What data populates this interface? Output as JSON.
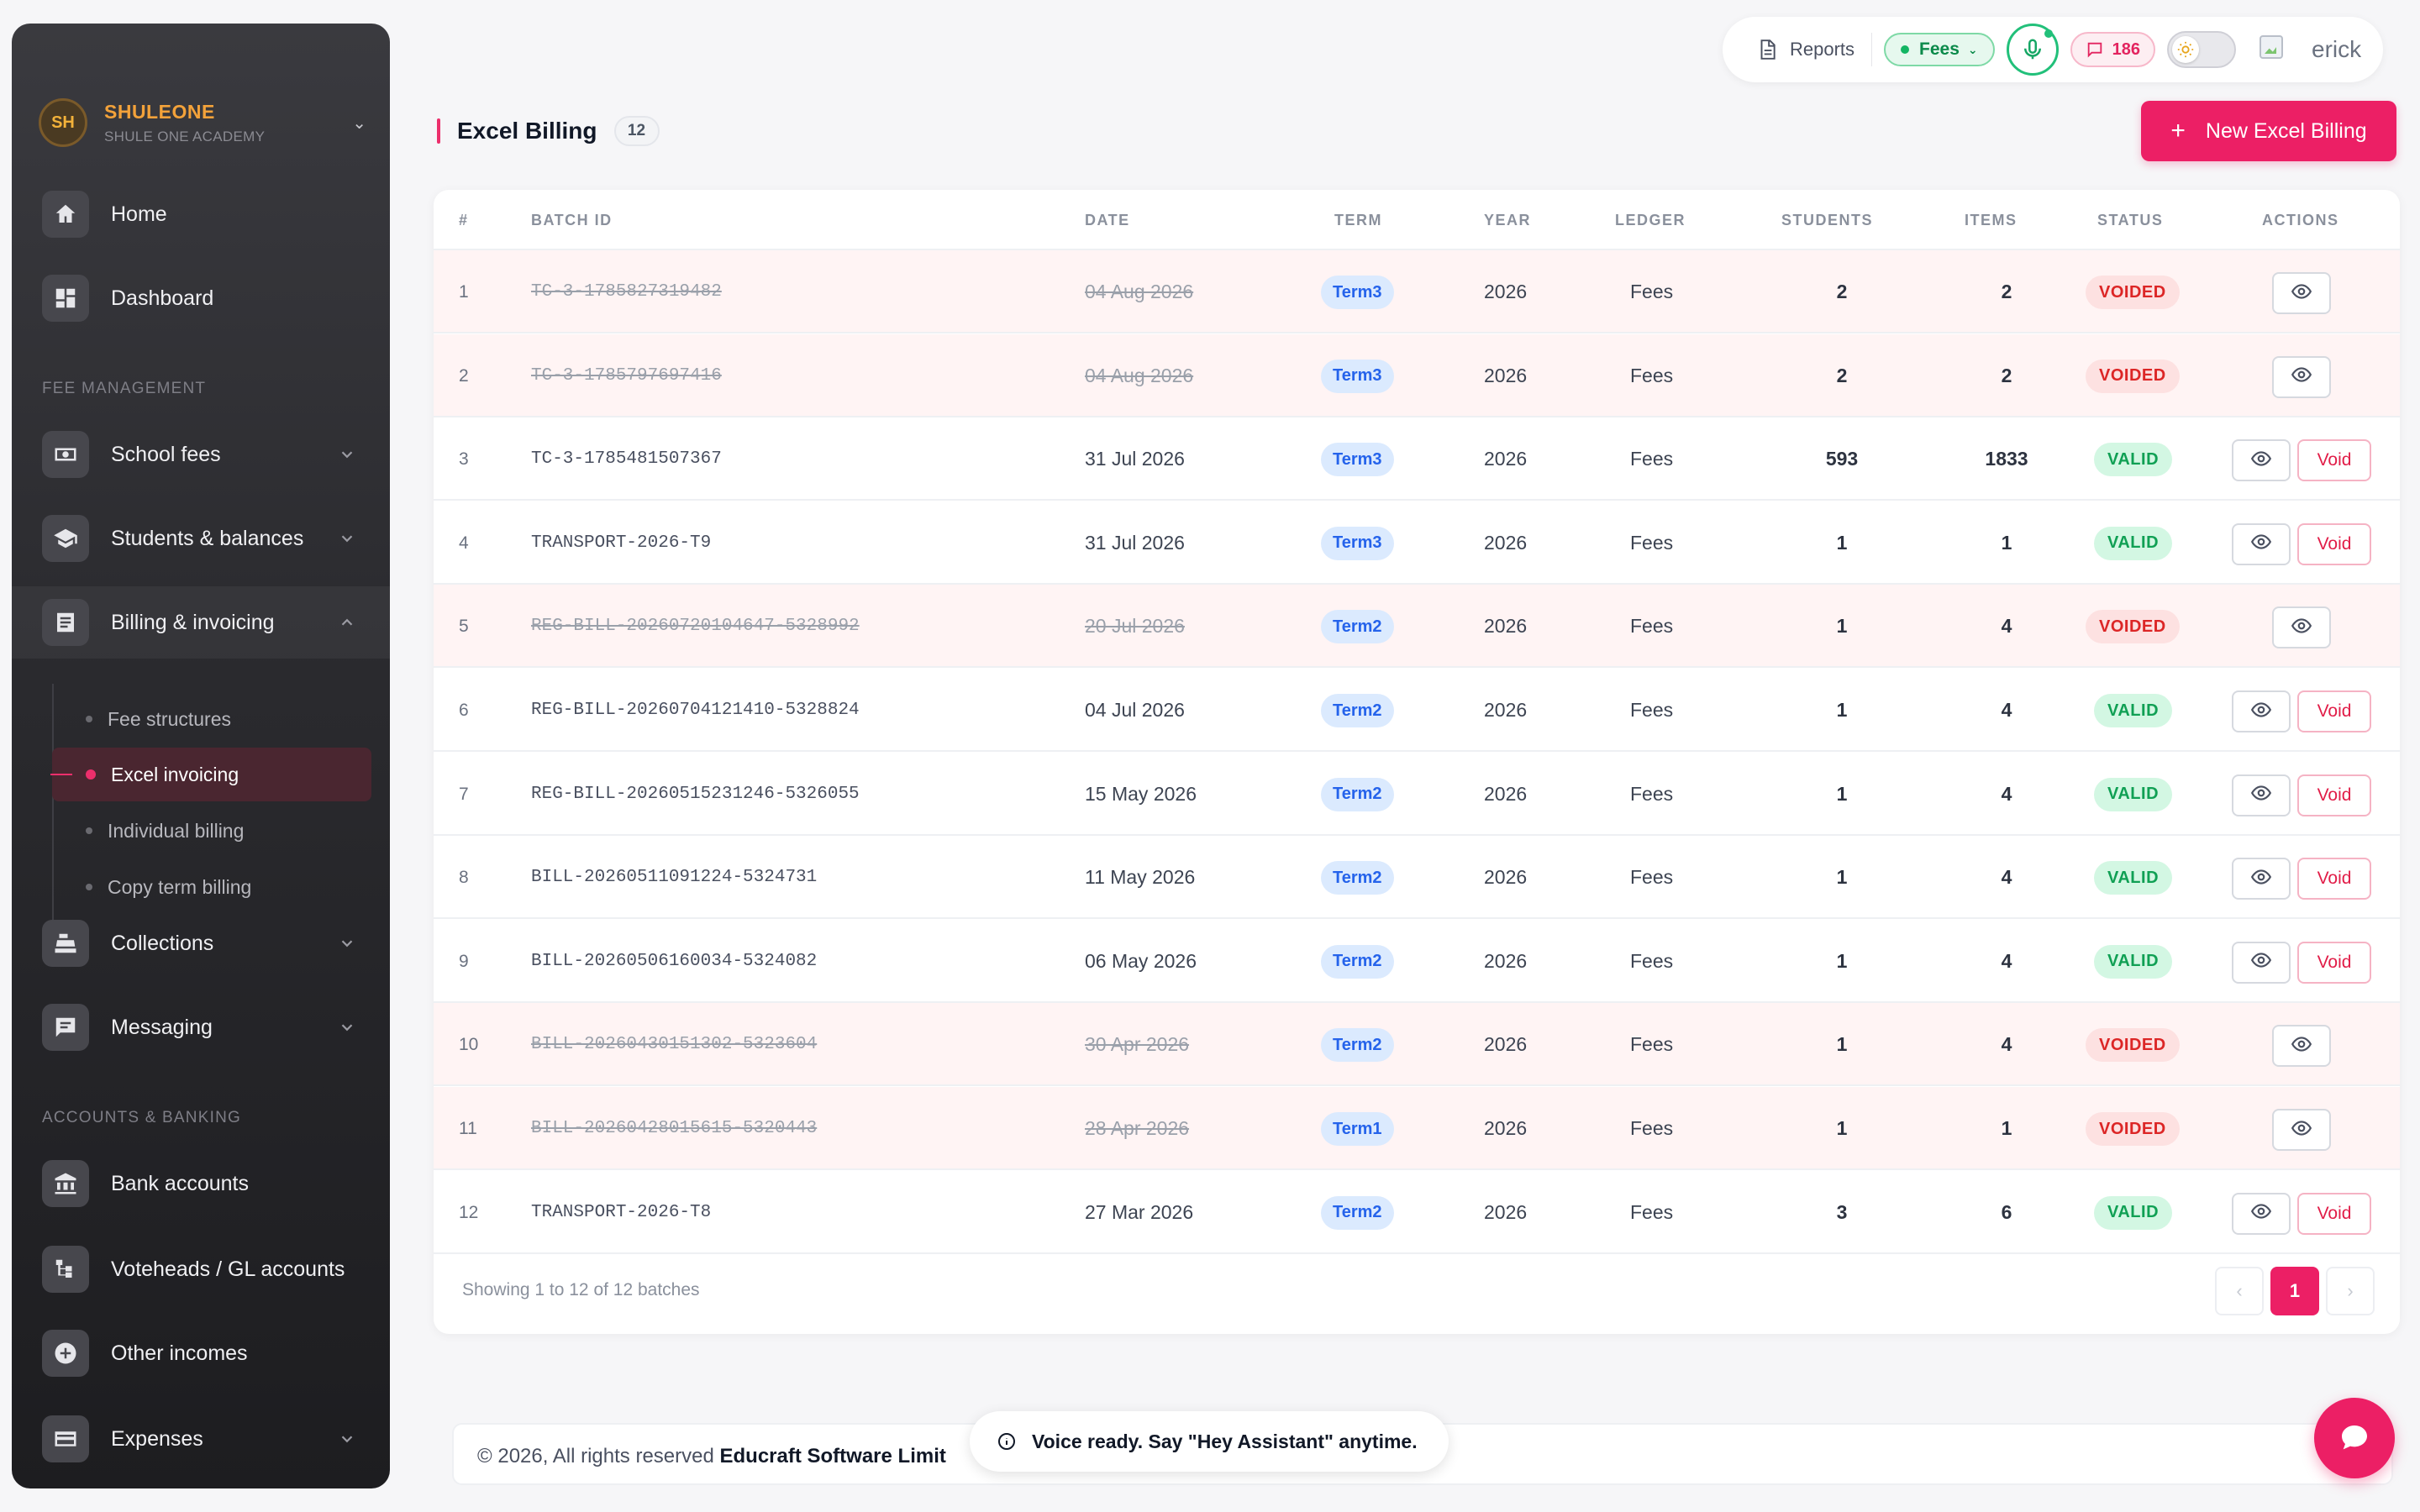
{
  "brand": {
    "initials": "SH",
    "name": "SHULEONE",
    "subtitle": "SHULE ONE ACADEMY"
  },
  "sidebar": {
    "items_top": [
      {
        "label": "Home",
        "icon": "home-icon"
      },
      {
        "label": "Dashboard",
        "icon": "dashboard-icon"
      }
    ],
    "section_fee": "FEE MANAGEMENT",
    "items_fee": [
      {
        "label": "School fees",
        "icon": "money-icon"
      },
      {
        "label": "Students & balances",
        "icon": "graduation-cap-icon"
      },
      {
        "label": "Billing & invoicing",
        "icon": "receipt-icon"
      }
    ],
    "sub_items": [
      {
        "label": "Fee structures"
      },
      {
        "label": "Excel invoicing"
      },
      {
        "label": "Individual billing"
      },
      {
        "label": "Copy term billing"
      }
    ],
    "items_mid": [
      {
        "label": "Collections",
        "icon": "cash-register-icon"
      },
      {
        "label": "Messaging",
        "icon": "chat-icon"
      }
    ],
    "section_accounts": "ACCOUNTS & BANKING",
    "items_accounts": [
      {
        "label": "Bank accounts",
        "icon": "bank-icon"
      },
      {
        "label": "Voteheads / GL accounts",
        "icon": "tree-icon"
      },
      {
        "label": "Other incomes",
        "icon": "plus-circle-icon"
      },
      {
        "label": "Expenses",
        "icon": "card-icon"
      }
    ]
  },
  "topbar": {
    "reports_label": "Reports",
    "fees_label": "Fees",
    "message_count": "186",
    "username": "erick"
  },
  "page": {
    "title": "Excel Billing",
    "count": "12",
    "new_button": "New Excel Billing"
  },
  "table": {
    "headers": [
      "#",
      "BATCH ID",
      "DATE",
      "TERM",
      "YEAR",
      "LEDGER",
      "STUDENTS",
      "ITEMS",
      "STATUS",
      "ACTIONS"
    ],
    "rows": [
      {
        "num": "1",
        "batch": "TC-3-1785827319482",
        "date": "04 Aug 2026",
        "term": "Term3",
        "year": "2026",
        "ledger": "Fees",
        "students": "2",
        "items": "2",
        "status": "VOIDED"
      },
      {
        "num": "2",
        "batch": "TC-3-1785797697416",
        "date": "04 Aug 2026",
        "term": "Term3",
        "year": "2026",
        "ledger": "Fees",
        "students": "2",
        "items": "2",
        "status": "VOIDED"
      },
      {
        "num": "3",
        "batch": "TC-3-1785481507367",
        "date": "31 Jul 2026",
        "term": "Term3",
        "year": "2026",
        "ledger": "Fees",
        "students": "593",
        "items": "1833",
        "status": "VALID"
      },
      {
        "num": "4",
        "batch": "TRANSPORT-2026-T9",
        "date": "31 Jul 2026",
        "term": "Term3",
        "year": "2026",
        "ledger": "Fees",
        "students": "1",
        "items": "1",
        "status": "VALID"
      },
      {
        "num": "5",
        "batch": "REG-BILL-20260720104647-5328992",
        "date": "20 Jul 2026",
        "term": "Term2",
        "year": "2026",
        "ledger": "Fees",
        "students": "1",
        "items": "4",
        "status": "VOIDED"
      },
      {
        "num": "6",
        "batch": "REG-BILL-20260704121410-5328824",
        "date": "04 Jul 2026",
        "term": "Term2",
        "year": "2026",
        "ledger": "Fees",
        "students": "1",
        "items": "4",
        "status": "VALID"
      },
      {
        "num": "7",
        "batch": "REG-BILL-20260515231246-5326055",
        "date": "15 May 2026",
        "term": "Term2",
        "year": "2026",
        "ledger": "Fees",
        "students": "1",
        "items": "4",
        "status": "VALID"
      },
      {
        "num": "8",
        "batch": "BILL-20260511091224-5324731",
        "date": "11 May 2026",
        "term": "Term2",
        "year": "2026",
        "ledger": "Fees",
        "students": "1",
        "items": "4",
        "status": "VALID"
      },
      {
        "num": "9",
        "batch": "BILL-20260506160034-5324082",
        "date": "06 May 2026",
        "term": "Term2",
        "year": "2026",
        "ledger": "Fees",
        "students": "1",
        "items": "4",
        "status": "VALID"
      },
      {
        "num": "10",
        "batch": "BILL-20260430151302-5323604",
        "date": "30 Apr 2026",
        "term": "Term2",
        "year": "2026",
        "ledger": "Fees",
        "students": "1",
        "items": "4",
        "status": "VOIDED"
      },
      {
        "num": "11",
        "batch": "BILL-20260428015615-5320443",
        "date": "28 Apr 2026",
        "term": "Term1",
        "year": "2026",
        "ledger": "Fees",
        "students": "1",
        "items": "1",
        "status": "VOIDED"
      },
      {
        "num": "12",
        "batch": "TRANSPORT-2026-T8",
        "date": "27 Mar 2026",
        "term": "Term2",
        "year": "2026",
        "ledger": "Fees",
        "students": "3",
        "items": "6",
        "status": "VALID"
      }
    ],
    "void_label": "Void",
    "showing_text": "Showing 1 to 12 of 12 batches",
    "pagination": {
      "prev": "‹",
      "current": "1",
      "next": "›"
    }
  },
  "footer": {
    "copyright": "© 2026, All rights reserved ",
    "company": "Educraft Software Limit"
  },
  "toast": {
    "message": "Voice ready. Say \"Hey Assistant\" anytime."
  },
  "colors": {
    "accent": "#ec1f65",
    "valid": "#10a054",
    "voided": "#dc2626",
    "term": "#2563eb"
  }
}
